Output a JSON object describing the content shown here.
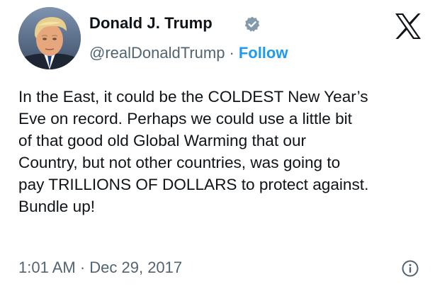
{
  "author": {
    "name": "Donald J. Trump",
    "handle": "@realDonaldTrump",
    "separator": "·",
    "follow_label": "Follow",
    "avatar_icon": "profile-photo",
    "verified_icon": "verified-badge-icon"
  },
  "platform": {
    "logo_icon": "x-logo-icon"
  },
  "tweet": {
    "text": "In the East, it could be the COLDEST New Year’s\nEve on record. Perhaps we could use a little bit\nof that good old Global Warming that our\nCountry, but not other countries, was going to\npay TRILLIONS OF DOLLARS to protect against.\nBundle up!",
    "timestamp": "1:01 AM · Dec 29, 2017"
  },
  "colors": {
    "text": "#0f1419",
    "secondary": "#536471",
    "accent": "#1d9bf0",
    "badge": "#829aab"
  },
  "info_icon": "info-icon"
}
